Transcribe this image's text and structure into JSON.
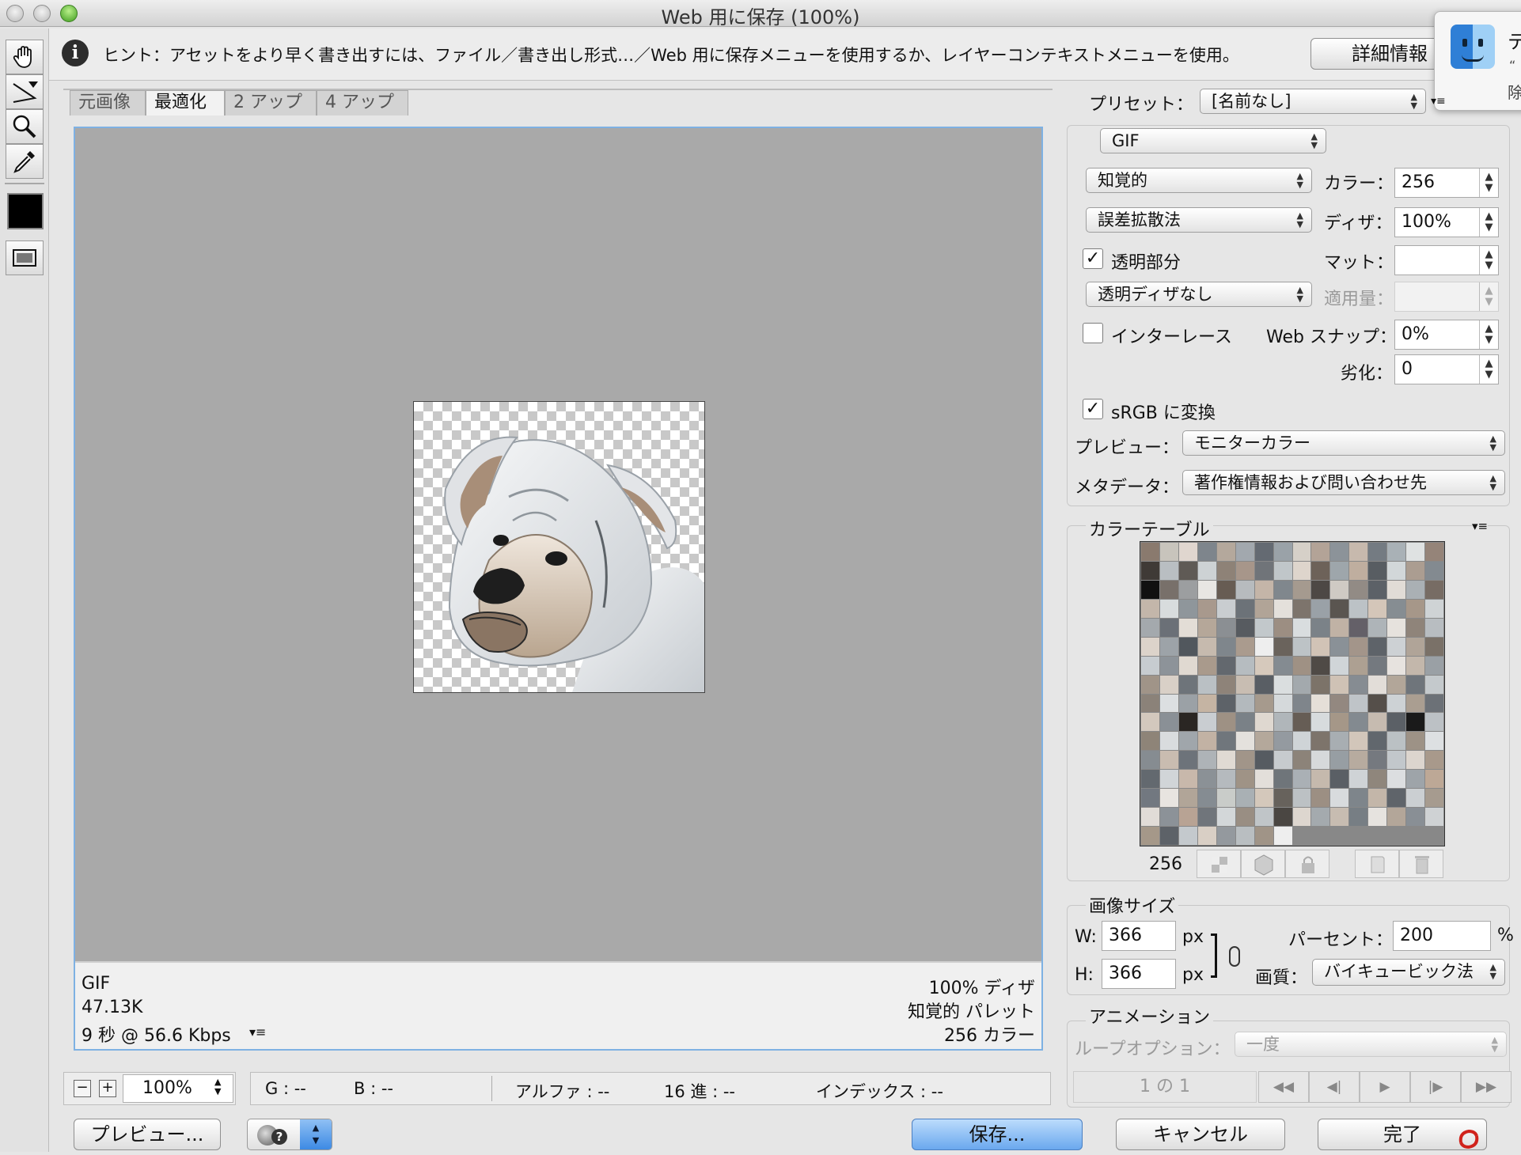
{
  "window": {
    "title": "Web 用に保存 (100%)"
  },
  "hint": {
    "text": "ヒント：アセットをより早く書き出すには、ファイル／書き出し形式…／Web 用に保存メニューを使用するか、レイヤーコンテキストメニューを使用。",
    "details_button": "詳細情報"
  },
  "notification": {
    "title_fragment": "テ",
    "line1": "“",
    "line2": "除"
  },
  "tabs": [
    "元画像",
    "最適化",
    "2 アップ",
    "4 アップ"
  ],
  "info_left": [
    "GIF",
    "47.13K",
    "9 秒 @ 56.6 Kbps"
  ],
  "info_right": [
    "100% ディザ",
    "知覚的 パレット",
    "256 カラー"
  ],
  "zoom": {
    "minus": "−",
    "plus": "+",
    "value": "100%"
  },
  "readout": {
    "g": "G : --",
    "b": "B : --",
    "alpha": "アルファ : --",
    "hex": "16 進 : --",
    "index": "インデックス : --"
  },
  "buttons": {
    "preview": "プレビュー...",
    "save": "保存...",
    "cancel": "キャンセル",
    "done": "完了"
  },
  "preset": {
    "label": "プリセット：",
    "value": "[名前なし]"
  },
  "format": "GIF",
  "reduction": "知覚的",
  "colors": {
    "label": "カラー：",
    "value": "256"
  },
  "dither_algo": "誤差拡散法",
  "dither": {
    "label": "ディザ：",
    "value": "100%"
  },
  "transparency": {
    "label": "透明部分",
    "checked": true
  },
  "matte": {
    "label": "マット：",
    "value": ""
  },
  "transparency_dither": "透明ディザなし",
  "amount": {
    "label": "適用量：",
    "value": ""
  },
  "interlace": {
    "label": "インターレース",
    "checked": false
  },
  "websnap": {
    "label": "Web スナップ：",
    "value": "0%"
  },
  "lossy": {
    "label": "劣化：",
    "value": "0"
  },
  "srgb": {
    "label": "sRGB に変換",
    "checked": true
  },
  "preview_setting": {
    "label": "プレビュー：",
    "value": "モニターカラー"
  },
  "metadata": {
    "label": "メタデータ：",
    "value": "著作権情報および問い合わせ先"
  },
  "color_table": {
    "title": "カラーテーブル",
    "count": "256",
    "colors": [
      "#8a7a6e",
      "#c8c4bc",
      "#e0d6cf",
      "#7e858c",
      "#b4a89c",
      "#a2a8ae",
      "#646a72",
      "#9aa2a8",
      "#d6d0c8",
      "#b3a397",
      "#8c9399",
      "#c7b9ad",
      "#747b82",
      "#a9b1b6",
      "#dfe2e2",
      "#958479",
      "#3f3a36",
      "#b9bec2",
      "#5f5a55",
      "#cdd2d4",
      "#8e8277",
      "#a7968a",
      "#707479",
      "#c0c6c9",
      "#ded5cc",
      "#6d6259",
      "#9ea6ab",
      "#bfae9f",
      "#585d62",
      "#d2d7d9",
      "#ab9d91",
      "#838a90",
      "#111111",
      "#78706a",
      "#9c9ea0",
      "#e8e6e3",
      "#675c53",
      "#b7bbbe",
      "#c4b5a8",
      "#80878d",
      "#a59a8f",
      "#4d4845",
      "#cfcac4",
      "#928b85",
      "#5c6167",
      "#e1dcd6",
      "#aab0b4",
      "#776c64",
      "#c3b6aa",
      "#d8dcdd",
      "#8f969b",
      "#a8998d",
      "#c9cdd0",
      "#6c7278",
      "#b1a497",
      "#e4e0db",
      "#7d746c",
      "#9aa1a7",
      "#5a5550",
      "#bcc2c6",
      "#d4c6b9",
      "#868d92",
      "#a69789",
      "#cfd3d5",
      "#a4a9ad",
      "#6b7077",
      "#e3ddd6",
      "#b5a799",
      "#8b8f93",
      "#575b60",
      "#c2c8cb",
      "#9c8e82",
      "#d9dddf",
      "#7b8288",
      "#c0b2a5",
      "#646068",
      "#aeb4b8",
      "#e6e2dd",
      "#8f847a",
      "#b8bdc1",
      "#dcd3ca",
      "#9da3a8",
      "#51575d",
      "#c6baae",
      "#7f868c",
      "#aa9b8e",
      "#eeeeee",
      "#6a635c",
      "#bdc3c6",
      "#d1c3b6",
      "#8a9197",
      "#a3958a",
      "#5e6369",
      "#cdd1d4",
      "#b0a498",
      "#7a7168",
      "#c7ccd0",
      "#8d9399",
      "#e0d9d1",
      "#a99a8c",
      "#63686e",
      "#b6bcc0",
      "#d6c9bc",
      "#848b91",
      "#9f9184",
      "#4f4a46",
      "#d0d5d8",
      "#ada092",
      "#74797f",
      "#e7e3df",
      "#c3b7ab",
      "#9aa0a5",
      "#a09488",
      "#d9d0c7",
      "#6e747a",
      "#bac0c4",
      "#8e8379",
      "#c8bdb2",
      "#595e64",
      "#dadedf",
      "#a3a9ad",
      "#7c7369",
      "#cfc2b5",
      "#868c92",
      "#e2ddd8",
      "#b2a699",
      "#6f757b",
      "#c4c9cc",
      "#8b8279",
      "#dcdfe1",
      "#9ba1a6",
      "#c5b4a3",
      "#5d6268",
      "#b3b9bd",
      "#a69a8d",
      "#d5d9db",
      "#7f858b",
      "#e5dfd8",
      "#938880",
      "#bfc4c8",
      "#554f4a",
      "#cdd2d5",
      "#aa9e91",
      "#6c7177",
      "#d3c8bd",
      "#8a9096",
      "#2a2623",
      "#c9cdd1",
      "#9e9184",
      "#7a8187",
      "#dfd8d0",
      "#b0b6ba",
      "#665d55",
      "#d7dbdd",
      "#a59788",
      "#838a90",
      "#c6bbb0",
      "#5b6066",
      "#1a1a1a",
      "#bcc1c5",
      "#8e8478",
      "#d9dcde",
      "#a0a6ab",
      "#c2b2a4",
      "#70767c",
      "#e4e1dd",
      "#b4a89b",
      "#949aa0",
      "#cfd4d7",
      "#7d746b",
      "#a8aeb2",
      "#d2c6ba",
      "#61676d",
      "#bbc1c4",
      "#9d9286",
      "#dde0e2",
      "#868c91",
      "#c9bcb0",
      "#6d737a",
      "#aeb3b7",
      "#e0dad3",
      "#a19589",
      "#565b61",
      "#c7cbce",
      "#8c8379",
      "#d6d9db",
      "#979ea3",
      "#b7ab9f",
      "#75797f",
      "#c2c7cb",
      "#dcd5ce",
      "#a8998b",
      "#63696f",
      "#d1d5d8",
      "#c8b8ab",
      "#8b9196",
      "#b5babe",
      "#9f9386",
      "#e3dfda",
      "#6f757a",
      "#aab0b5",
      "#c5b9ad",
      "#5a5f65",
      "#cfd3d6",
      "#8f867c",
      "#dcdee0",
      "#9ea4a9",
      "#bda896",
      "#727880",
      "#e8e4e0",
      "#b1a598",
      "#858c92",
      "#c9ccc9",
      "#a9b0b4",
      "#d4c8bb",
      "#67625c",
      "#bcc1c4",
      "#9c8f83",
      "#d8dbdd",
      "#7e858b",
      "#c3b6a9",
      "#5f646a",
      "#cbcfd2",
      "#a69b8f",
      "#e1dcd7",
      "#8c9298",
      "#b8a394",
      "#70757b",
      "#d3d7d9",
      "#998e83",
      "#c0c5c8",
      "#4a4642",
      "#ddd6cf",
      "#a4aaae",
      "#c7bcb1",
      "#777e84",
      "#e6e3df",
      "#b3a699",
      "#898f95",
      "#cfd2d4",
      "#a59889",
      "#5d6268",
      "#c4c9cd",
      "#d9cfc5",
      "#94999e",
      "#b9bec1",
      "#a09487",
      "#eeeeee"
    ]
  },
  "image_size": {
    "title": "画像サイズ",
    "w_label": "W:",
    "w_value": "366",
    "w_unit": "px",
    "h_label": "H:",
    "h_value": "366",
    "h_unit": "px",
    "percent_label": "パーセント：",
    "percent_value": "200",
    "percent_unit": "%",
    "quality_label": "画質：",
    "quality_value": "バイキュービック法"
  },
  "animation": {
    "title": "アニメーション",
    "loop_label": "ループオプション：",
    "loop_value": "一度",
    "frame": "1 の 1"
  }
}
